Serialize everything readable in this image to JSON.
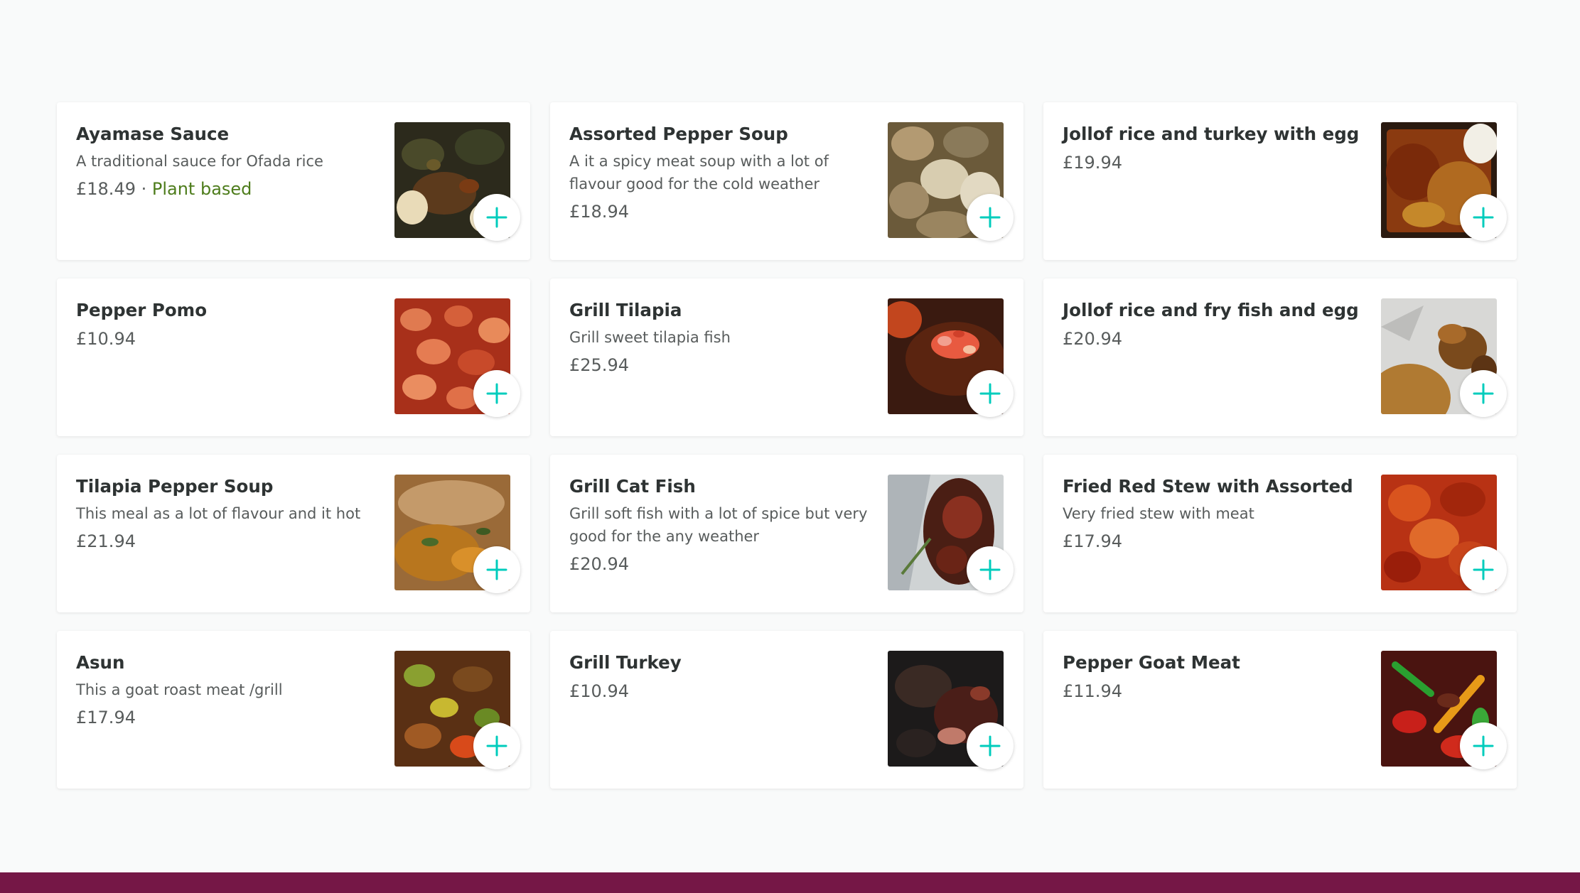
{
  "colors": {
    "accent": "#00ccbc",
    "tag": "#4d7c1b",
    "footer": "#751746",
    "background": "#f9fafa"
  },
  "items": [
    {
      "name": "Ayamase Sauce",
      "description": "A traditional sauce for Ofada rice",
      "price": "£18.49",
      "separator": " · ",
      "tag": "Plant based",
      "add_icon": "plus-icon"
    },
    {
      "name": "Assorted Pepper Soup",
      "description": "A it a spicy meat soup with a lot of flavour good for the cold weather",
      "price": "£18.94",
      "add_icon": "plus-icon"
    },
    {
      "name": "Jollof rice and turkey with egg",
      "description": "",
      "price": "£19.94",
      "add_icon": "plus-icon"
    },
    {
      "name": "Pepper Pomo",
      "description": "",
      "price": "£10.94",
      "add_icon": "plus-icon"
    },
    {
      "name": "Grill Tilapia",
      "description": "Grill sweet tilapia fish",
      "price": "£25.94",
      "add_icon": "plus-icon"
    },
    {
      "name": "Jollof rice and fry fish and egg",
      "description": "",
      "price": "£20.94",
      "add_icon": "plus-icon"
    },
    {
      "name": "Tilapia Pepper Soup",
      "description": "This meal as a lot of flavour and it hot",
      "price": "£21.94",
      "add_icon": "plus-icon"
    },
    {
      "name": "Grill Cat Fish",
      "description": "Grill soft fish with a lot of spice but very good for the any weather",
      "price": "£20.94",
      "add_icon": "plus-icon"
    },
    {
      "name": "Fried Red Stew with Assorted",
      "description": "Very fried stew with meat",
      "price": "£17.94",
      "add_icon": "plus-icon"
    },
    {
      "name": "Asun",
      "description": "This a goat roast meat /grill",
      "price": "£17.94",
      "add_icon": "plus-icon"
    },
    {
      "name": "Grill Turkey",
      "description": "",
      "price": "£10.94",
      "add_icon": "plus-icon"
    },
    {
      "name": "Pepper Goat Meat",
      "description": "",
      "price": "£11.94",
      "add_icon": "plus-icon"
    }
  ]
}
